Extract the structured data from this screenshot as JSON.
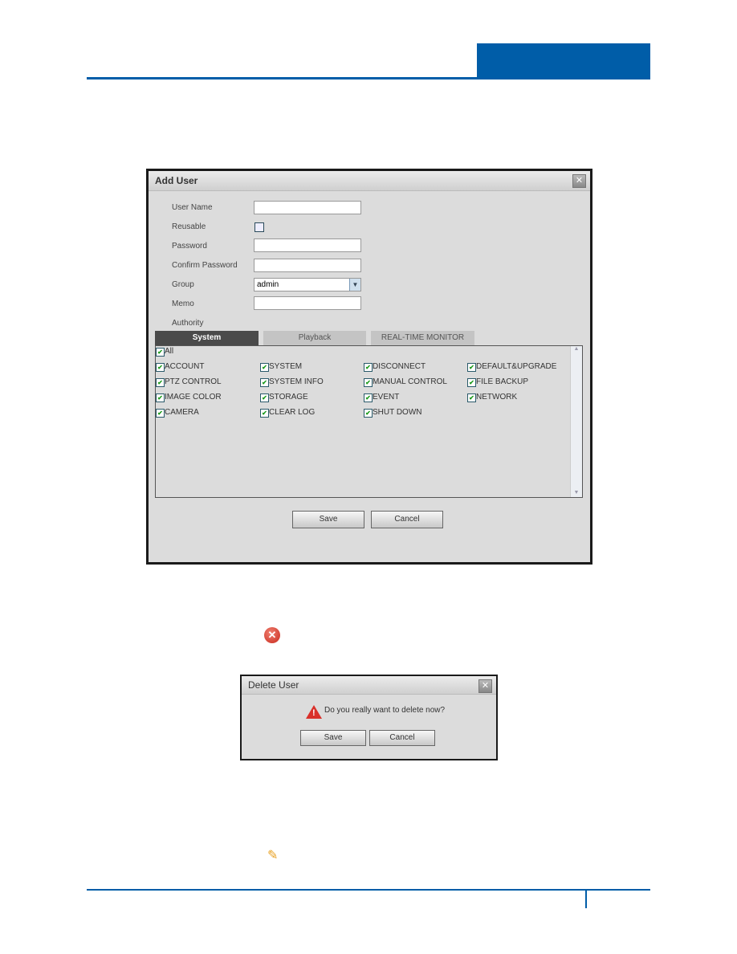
{
  "add_user": {
    "title": "Add User",
    "fields": [
      {
        "label": "User Name",
        "value": ""
      },
      {
        "label": "Reusable",
        "checked": false
      },
      {
        "label": "Password",
        "value": ""
      },
      {
        "label": "Confirm Password",
        "value": ""
      },
      {
        "label": "Group",
        "value": "admin"
      },
      {
        "label": "Memo",
        "value": ""
      }
    ],
    "authority_label": "Authority",
    "tabs": [
      "System",
      "Playback",
      "REAL-TIME MONITOR"
    ],
    "active_tab": "System",
    "all_label": "All",
    "permissions": [
      [
        "ACCOUNT",
        "SYSTEM",
        "DISCONNECT",
        "DEFAULT&UPGRADE"
      ],
      [
        "PTZ CONTROL",
        "SYSTEM INFO",
        "MANUAL CONTROL",
        "FILE BACKUP"
      ],
      [
        "IMAGE COLOR",
        "STORAGE",
        "EVENT",
        "NETWORK"
      ],
      [
        "CAMERA",
        "CLEAR LOG",
        "SHUT DOWN"
      ]
    ],
    "save": "Save",
    "cancel": "Cancel"
  },
  "delete_user": {
    "title": "Delete User",
    "message": "Do you really want to delete now?",
    "save": "Save",
    "cancel": "Cancel"
  },
  "colors": {
    "brand": "#005da8"
  }
}
